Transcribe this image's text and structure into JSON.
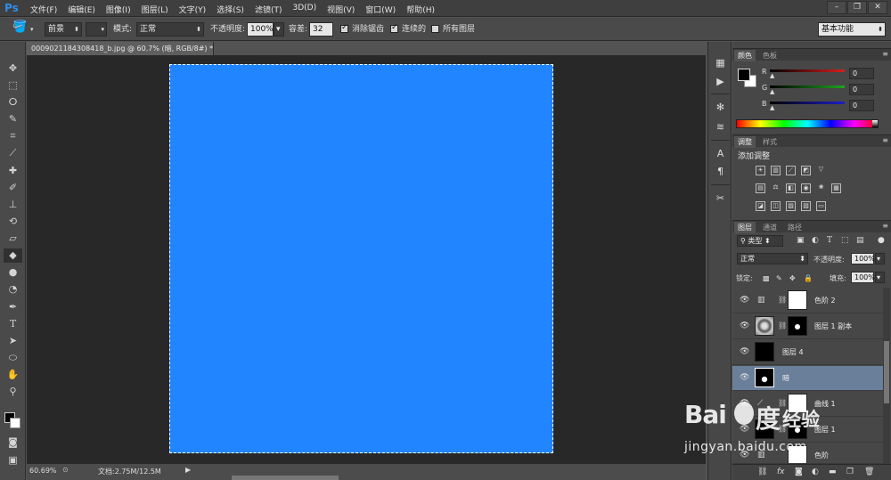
{
  "app": {
    "logo": "Ps",
    "menus": [
      "文件(F)",
      "编辑(E)",
      "图像(I)",
      "图层(L)",
      "文字(Y)",
      "选择(S)",
      "滤镜(T)",
      "3D(D)",
      "视图(V)",
      "窗口(W)",
      "帮助(H)"
    ],
    "window_controls": [
      "–",
      "❐",
      "✕"
    ]
  },
  "options_bar": {
    "fill_source": "前景",
    "mode_label": "模式:",
    "mode_value": "正常",
    "opacity_label": "不透明度:",
    "opacity_value": "100%",
    "tolerance_label": "容差:",
    "tolerance_value": "32",
    "antialias_label": "消除锯齿",
    "antialias_checked": true,
    "contiguous_label": "连续的",
    "contiguous_checked": true,
    "all_layers_label": "所有图层",
    "all_layers_checked": false,
    "workspace": "基本功能"
  },
  "document": {
    "tab_title": "0009021184308418_b.jpg @ 60.7% (暗, RGB/8#) *",
    "canvas_color": "#2085ff",
    "status_zoom": "60.69%",
    "status_info": "文档:2.75M/12.5M"
  },
  "color_panel": {
    "tabs": [
      "颜色",
      "色板"
    ],
    "sliders": [
      {
        "label": "R",
        "value": "0",
        "color": "#d91e1e"
      },
      {
        "label": "G",
        "value": "0",
        "color": "#1ea51e"
      },
      {
        "label": "B",
        "value": "0",
        "color": "#1e1ec8"
      }
    ]
  },
  "adjustments_panel": {
    "tabs": [
      "调整",
      "样式"
    ],
    "title": "添加调整"
  },
  "layers_panel": {
    "tabs": [
      "图层",
      "通道",
      "路径"
    ],
    "filter_kind": "类型",
    "blend_mode": "正常",
    "opacity_label": "不透明度:",
    "opacity_value": "100%",
    "lock_label": "锁定:",
    "fill_label": "填充:",
    "fill_value": "100%",
    "layers": [
      {
        "name": "色阶 2",
        "selected": false
      },
      {
        "name": "图层 1 副本",
        "selected": false
      },
      {
        "name": "图层 4",
        "selected": false
      },
      {
        "name": "暗",
        "selected": true
      },
      {
        "name": "曲线 1",
        "selected": false
      },
      {
        "name": "图层 1",
        "selected": false
      },
      {
        "name": "色阶",
        "selected": false
      }
    ],
    "bottom_icons": [
      "link-icon",
      "fx-icon",
      "mask-icon",
      "adjustment-icon",
      "group-icon",
      "new-layer-icon",
      "trash-icon"
    ]
  },
  "watermark": {
    "brand": "Bai",
    "brand_cn": "度",
    "product": "经验",
    "url": "jingyan.baidu.com"
  }
}
